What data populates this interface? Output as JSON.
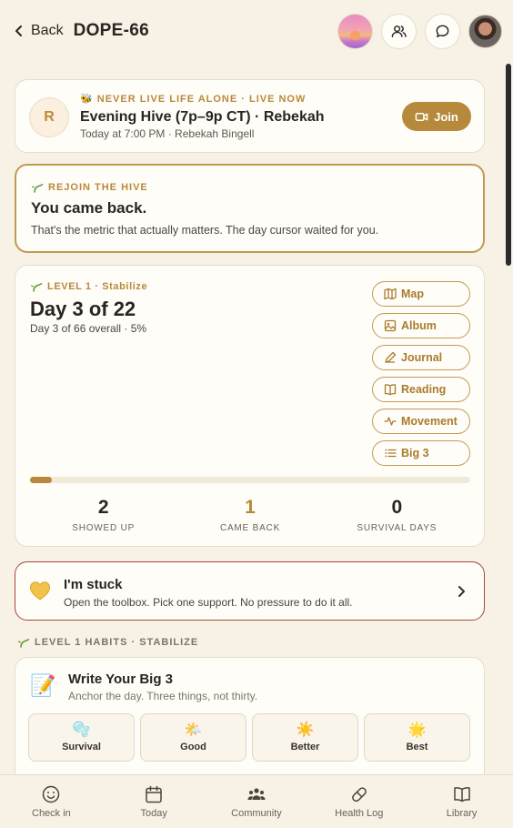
{
  "header": {
    "back_label": "Back",
    "title": "DOPE-66",
    "icons": [
      "sunset-avatar",
      "people-icon",
      "chat-icon",
      "user-photo-avatar"
    ]
  },
  "live": {
    "avatar_initial": "R",
    "kicker": "NEVER LIVE LIFE ALONE · LIVE NOW",
    "kicker_emoji": "🐝",
    "title": "Evening Hive (7p–9p CT) · Rebekah",
    "subtitle": "Today at 7:00 PM · Rebekah Bingell",
    "join_label": "Join"
  },
  "rejoin": {
    "kicker": "REJOIN THE HIVE",
    "title": "You came back.",
    "body": "That's the metric that actually matters. The day cursor waited for you."
  },
  "level": {
    "kicker": "LEVEL 1 · Stabilize",
    "title": "Day 3 of 22",
    "subtitle": "Day 3 of 66 overall · 5%",
    "progress_percent": 5,
    "actions": [
      {
        "label": "Map",
        "icon": "map-icon"
      },
      {
        "label": "Album",
        "icon": "image-icon"
      },
      {
        "label": "Journal",
        "icon": "pencil-icon"
      },
      {
        "label": "Reading",
        "icon": "book-icon"
      },
      {
        "label": "Movement",
        "icon": "pulse-icon"
      },
      {
        "label": "Big 3",
        "icon": "list-icon"
      }
    ],
    "stats": [
      {
        "value": "2",
        "label": "SHOWED UP"
      },
      {
        "value": "1",
        "label": "CAME BACK"
      },
      {
        "value": "0",
        "label": "SURVIVAL DAYS"
      }
    ]
  },
  "stuck": {
    "title": "I'm stuck",
    "body": "Open the toolbox. Pick one support. No pressure to do it all."
  },
  "habits_section": {
    "label": "LEVEL 1 HABITS · STABILIZE"
  },
  "habit": {
    "emoji": "📝",
    "title": "Write Your Big 3",
    "subtitle": "Anchor the day. Three things, not thirty.",
    "options": [
      {
        "label": "Survival",
        "emoji": "🫧"
      },
      {
        "label": "Good",
        "emoji": "🌤️"
      },
      {
        "label": "Better",
        "emoji": "☀️"
      },
      {
        "label": "Best",
        "emoji": "🌟"
      }
    ]
  },
  "bottomnav": [
    {
      "label": "Check in",
      "icon": "smile-icon"
    },
    {
      "label": "Today",
      "icon": "calendar-icon"
    },
    {
      "label": "Community",
      "icon": "community-icon"
    },
    {
      "label": "Health Log",
      "icon": "pill-icon"
    },
    {
      "label": "Library",
      "icon": "library-icon"
    }
  ],
  "colors": {
    "background": "#f7f1e6",
    "accent": "#b68a3a",
    "stuck_border": "#a5473a"
  }
}
